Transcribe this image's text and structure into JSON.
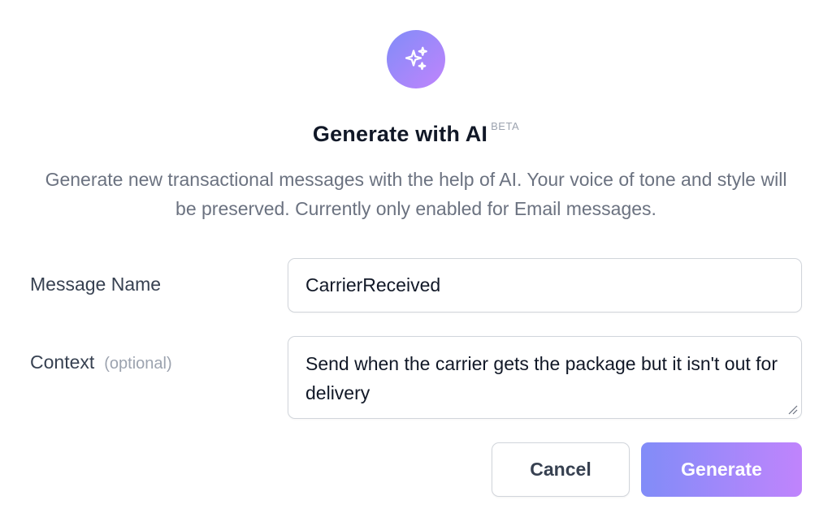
{
  "dialog": {
    "icon": "sparkles-icon",
    "title": "Generate with AI",
    "badge": "BETA",
    "description": "Generate new transactional messages with the help of AI. Your voice of tone and style will be preserved. Currently only enabled for Email messages."
  },
  "form": {
    "message_name": {
      "label": "Message Name",
      "value": "CarrierReceived"
    },
    "context": {
      "label": "Context",
      "hint": "(optional)",
      "value": "Send when the carrier gets the package but it isn't out for delivery"
    }
  },
  "actions": {
    "cancel_label": "Cancel",
    "generate_label": "Generate"
  },
  "colors": {
    "gradient_start": "#818cf8",
    "gradient_end": "#c084fc",
    "title": "#111827",
    "muted": "#6b7280",
    "border": "#d1d5db"
  }
}
